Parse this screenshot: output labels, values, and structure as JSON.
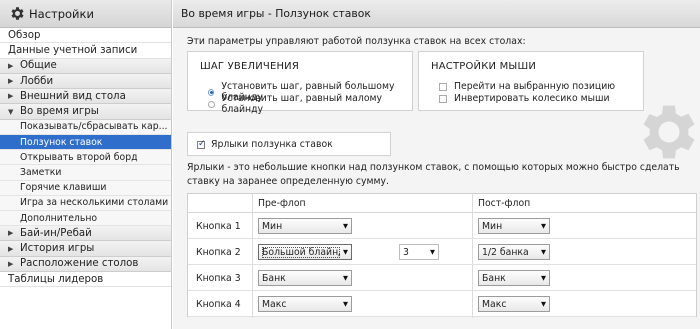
{
  "sidebar": {
    "title": "Настройки",
    "items": [
      {
        "label": "Обзор",
        "kind": "plain"
      },
      {
        "label": "Данные учетной записи",
        "kind": "plain"
      },
      {
        "label": "Общие",
        "kind": "section",
        "expanded": false
      },
      {
        "label": "Лобби",
        "kind": "section",
        "expanded": false
      },
      {
        "label": "Внешний вид стола",
        "kind": "section",
        "expanded": false
      },
      {
        "label": "Во время игры",
        "kind": "section",
        "expanded": true
      },
      {
        "label": "Показывать/сбрасывать кар...",
        "kind": "sub"
      },
      {
        "label": "Ползунок ставок",
        "kind": "sub",
        "active": true
      },
      {
        "label": "Открывать второй борд",
        "kind": "sub"
      },
      {
        "label": "Заметки",
        "kind": "sub"
      },
      {
        "label": "Горячие клавиши",
        "kind": "sub"
      },
      {
        "label": "Игра за несколькими столами",
        "kind": "sub"
      },
      {
        "label": "Дополнительно",
        "kind": "sub"
      },
      {
        "label": "Бай-ин/Ребай",
        "kind": "section",
        "expanded": false
      },
      {
        "label": "История игры",
        "kind": "section",
        "expanded": false
      },
      {
        "label": "Расположение столов",
        "kind": "section",
        "expanded": false
      },
      {
        "label": "Таблицы лидеров",
        "kind": "plain"
      }
    ]
  },
  "main": {
    "title": "Во время игры - Ползунок ставок",
    "intro": "Эти параметры управляют работой ползунка ставок на всех столах:",
    "step": {
      "title": "ШАГ УВЕЛИЧЕНИЯ",
      "options": [
        "Установить шаг, равный большому блайнду",
        "Установить шаг, равный малому блайнду"
      ],
      "selected_index": 0
    },
    "mouse": {
      "title": "НАСТРОЙКИ МЫШИ",
      "options": [
        "Перейти на выбранную позицию",
        "Инвертировать колесико мыши"
      ]
    },
    "labels_checkbox": {
      "label": "Ярлыки ползунка ставок",
      "checked": true
    },
    "labels_desc": "Ярлыки - это небольшие кнопки над ползунком ставок, с помощью которых можно быстро сделать ставку на заранее определенную сумму.",
    "table": {
      "headers": [
        "Пре-флоп",
        "Пост-флоп"
      ],
      "rows": [
        {
          "label": "Кнопка 1",
          "preflop": "Мин",
          "multiplier": "",
          "postflop": "Мин"
        },
        {
          "label": "Кнопка 2",
          "preflop": "Большой блайнд",
          "multiplier": "3",
          "postflop": "1/2 банка"
        },
        {
          "label": "Кнопка 3",
          "preflop": "Банк",
          "multiplier": "",
          "postflop": "Банк"
        },
        {
          "label": "Кнопка 4",
          "preflop": "Макс",
          "multiplier": "",
          "postflop": "Макс"
        }
      ]
    }
  },
  "icons": {
    "settings": "gear-icon",
    "dropdown": "triangle-down-icon",
    "collapsed": "triangle-right-icon",
    "expanded": "triangle-down-icon"
  },
  "colors": {
    "active_item": "#2f6fcb",
    "radio_dot": "#2d63bf"
  }
}
